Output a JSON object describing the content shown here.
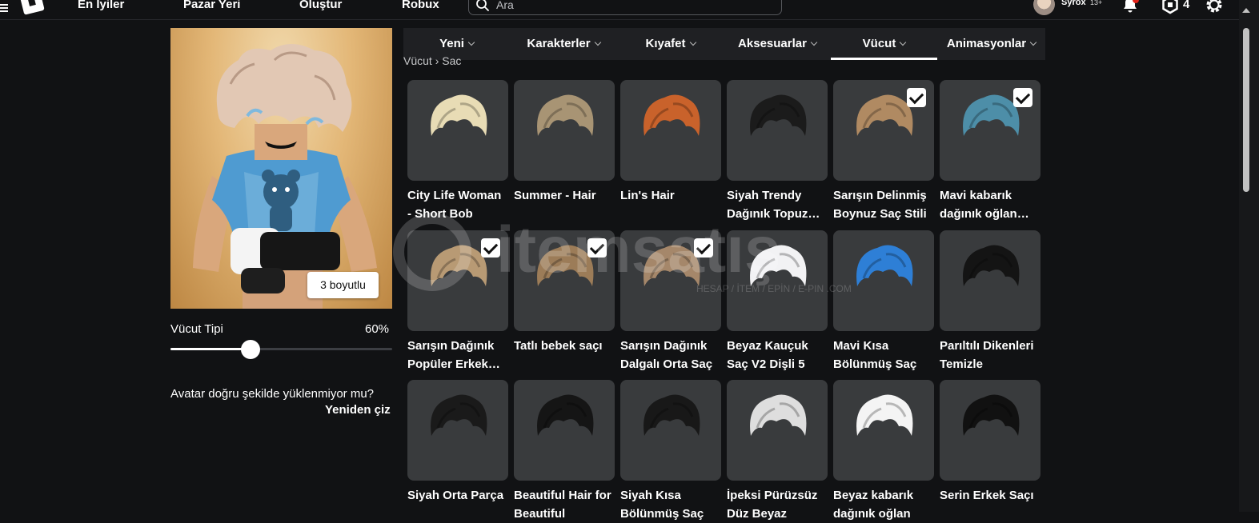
{
  "nav": {
    "links": [
      "En İyiler",
      "Pazar Yeri",
      "Oluştur",
      "Robux"
    ],
    "search_placeholder": "Ara",
    "username": "Syrox",
    "age_badge": "13+",
    "robux_count": "4"
  },
  "avatar": {
    "view_button": "3 boyutlu",
    "body_type_label": "Vücut Tipi",
    "body_type_value": "60%",
    "body_type_fraction": 0.6,
    "warning": "Avatar doğru şekilde yüklenmiyor mu?",
    "retry": "Yeniden çiz"
  },
  "tabs": [
    {
      "label": "Yeni"
    },
    {
      "label": "Karakterler"
    },
    {
      "label": "Kıyafet"
    },
    {
      "label": "Aksesuarlar"
    },
    {
      "label": "Vücut",
      "active": true
    },
    {
      "label": "Animasyonlar"
    }
  ],
  "breadcrumb": {
    "parent": "Vücut",
    "current": "Saç"
  },
  "items": [
    {
      "name": "City Life Woman - Short Bob",
      "equipped": false,
      "hair_color": "#e8dcb5"
    },
    {
      "name": "Summer - Hair",
      "equipped": false,
      "hair_color": "#a89474"
    },
    {
      "name": "Lin's Hair",
      "equipped": false,
      "hair_color": "#c9622b"
    },
    {
      "name": "Siyah Trendy Dağınık Topuz Saç",
      "equipped": false,
      "hair_color": "#1b1b1b"
    },
    {
      "name": "Sarışın Delinmiş Boynuz Saç Stili",
      "equipped": true,
      "hair_color": "#b08a62"
    },
    {
      "name": "Mavi kabarık dağınık oğlan saçı",
      "equipped": true,
      "hair_color": "#4d8ea8"
    },
    {
      "name": "Sarışın Dağınık Popüler Erkek Saçı",
      "equipped": true,
      "hair_color": "#b89a74"
    },
    {
      "name": "Tatlı bebek saçı",
      "equipped": true,
      "hair_color": "#9c7c58"
    },
    {
      "name": "Sarışın Dağınık Dalgalı Orta Saç",
      "equipped": true,
      "hair_color": "#a5876a"
    },
    {
      "name": "Beyaz Kauçuk Saç V2 Dişli 5",
      "equipped": false,
      "hair_color": "#f2f2f4"
    },
    {
      "name": "Mavi Kısa Bölünmüş Saç",
      "equipped": false,
      "hair_color": "#2e7fd6"
    },
    {
      "name": "Parıltılı Dikenleri Temizle",
      "equipped": false,
      "hair_color": "#141414"
    },
    {
      "name": "Siyah Orta Parça",
      "equipped": false,
      "hair_color": "#1a1a1a"
    },
    {
      "name": "Beautiful Hair for Beautiful",
      "equipped": false,
      "hair_color": "#151515"
    },
    {
      "name": "Siyah Kısa Bölünmüş Saç",
      "equipped": false,
      "hair_color": "#181818"
    },
    {
      "name": "İpeksi Pürüzsüz Düz Beyaz",
      "equipped": false,
      "hair_color": "#dedede"
    },
    {
      "name": "Beyaz kabarık dağınık oğlan",
      "equipped": false,
      "hair_color": "#f4f4f4"
    },
    {
      "name": "Serin Erkek Saçı",
      "equipped": false,
      "hair_color": "#111111"
    }
  ],
  "watermark": {
    "text": "itemsatış",
    "sub": "HESAP / İTEM / EPİN / E-PIN .COM"
  }
}
